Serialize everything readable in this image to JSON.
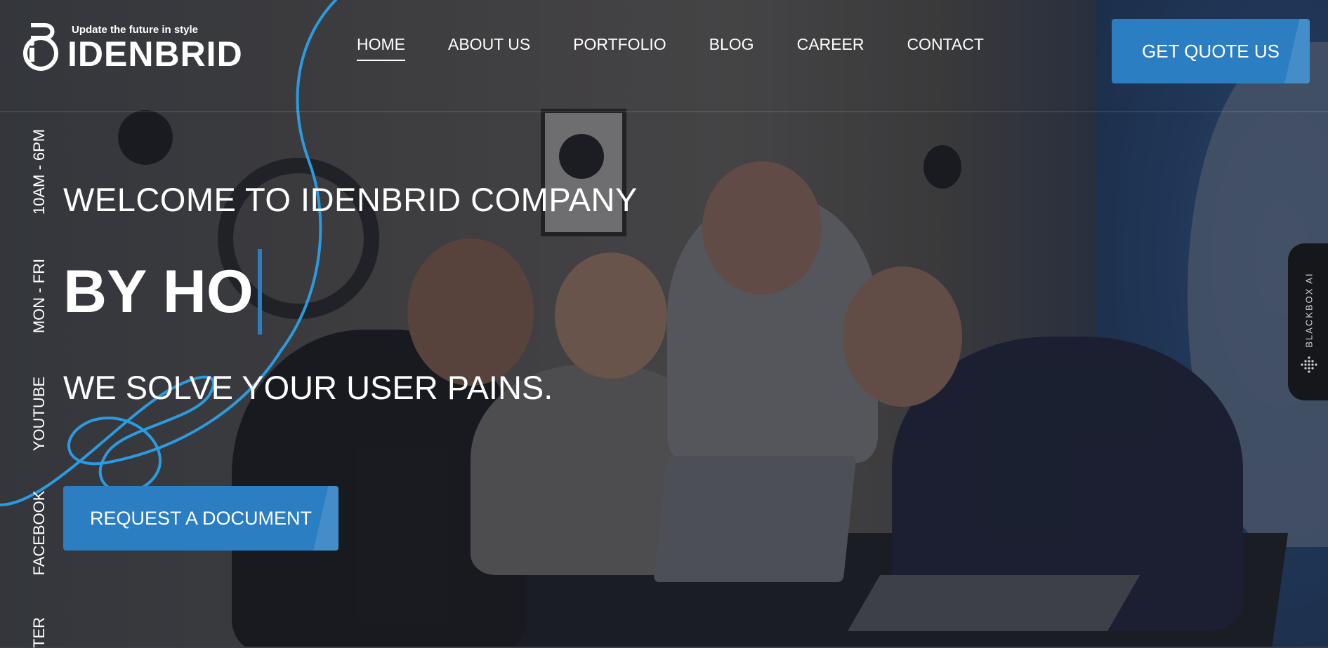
{
  "logo": {
    "tagline": "Update the future in style",
    "name": "IDENBRID"
  },
  "nav": {
    "items": [
      {
        "label": "HOME",
        "active": true
      },
      {
        "label": "ABOUT US",
        "active": false
      },
      {
        "label": "PORTFOLIO",
        "active": false
      },
      {
        "label": "BLOG",
        "active": false
      },
      {
        "label": "CAREER",
        "active": false
      },
      {
        "label": "CONTACT",
        "active": false
      }
    ],
    "cta_label": "GET QUOTE US"
  },
  "side": {
    "hours": "10AM - 6PM",
    "days": "MON - FRI",
    "youtube": "YOUTUBE",
    "facebook": "FACEBOOK",
    "twitter_partial": "TER"
  },
  "hero": {
    "welcome": "WELCOME TO IDENBRID COMPANY",
    "typed_text": "BY HO",
    "tagline": "WE SOLVE YOUR USER PAINS.",
    "button_label": "REQUEST A DOCUMENT"
  },
  "widget": {
    "label": "BLACKBOX AI"
  },
  "colors": {
    "accent": "#2b7ec1",
    "swirl": "#2b9be0",
    "text": "#ffffff"
  }
}
